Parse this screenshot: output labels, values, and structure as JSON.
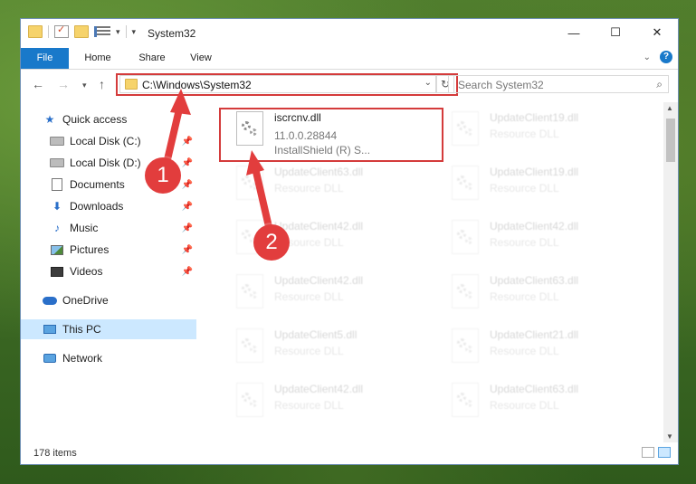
{
  "window": {
    "title": "System32"
  },
  "window_controls": {
    "minimize": "—",
    "maximize": "☐",
    "close": "✕"
  },
  "ribbon": {
    "tabs": [
      {
        "label": "File"
      },
      {
        "label": "Home"
      },
      {
        "label": "Share"
      },
      {
        "label": "View"
      }
    ],
    "help": "?"
  },
  "address_bar": {
    "path": "C:\\Windows\\System32"
  },
  "search": {
    "placeholder": "Search System32"
  },
  "nav_pane": {
    "items": [
      {
        "label": "Quick access"
      },
      {
        "label": "Local Disk (C:)"
      },
      {
        "label": "Local Disk (D:)"
      },
      {
        "label": "Documents"
      },
      {
        "label": "Downloads"
      },
      {
        "label": "Music"
      },
      {
        "label": "Pictures"
      },
      {
        "label": "Videos"
      },
      {
        "label": "OneDrive"
      },
      {
        "label": "This PC"
      },
      {
        "label": "Network"
      }
    ]
  },
  "files": [
    {
      "name": "iscrcnv.dll",
      "line1": "11.0.0.28844",
      "line2": "InstallShield (R) S..."
    },
    {
      "name": "UpdateClient19.dll",
      "line1": "Resource DLL"
    },
    {
      "name": "UpdateClient63.dll",
      "line1": "Resource DLL"
    },
    {
      "name": "UpdateClient19.dll",
      "line1": "Resource DLL"
    },
    {
      "name": "UpdateClient42.dll",
      "line1": "Resource DLL"
    },
    {
      "name": "UpdateClient42.dll",
      "line1": "Resource DLL"
    },
    {
      "name": "UpdateClient42.dll",
      "line1": "Resource DLL"
    },
    {
      "name": "UpdateClient63.dll",
      "line1": "Resource DLL"
    },
    {
      "name": "UpdateClient5.dll",
      "line1": "Resource DLL"
    },
    {
      "name": "UpdateClient21.dll",
      "line1": "Resource DLL"
    },
    {
      "name": "UpdateClient42.dll",
      "line1": "Resource DLL"
    },
    {
      "name": "UpdateClient63.dll",
      "line1": "Resource DLL"
    }
  ],
  "status_bar": {
    "item_count": "178 items"
  },
  "callouts": [
    {
      "label": "1"
    },
    {
      "label": "2"
    }
  ],
  "colors": {
    "accent": "#1979ca",
    "highlight": "#d43b3b",
    "selected": "#cce8ff"
  }
}
